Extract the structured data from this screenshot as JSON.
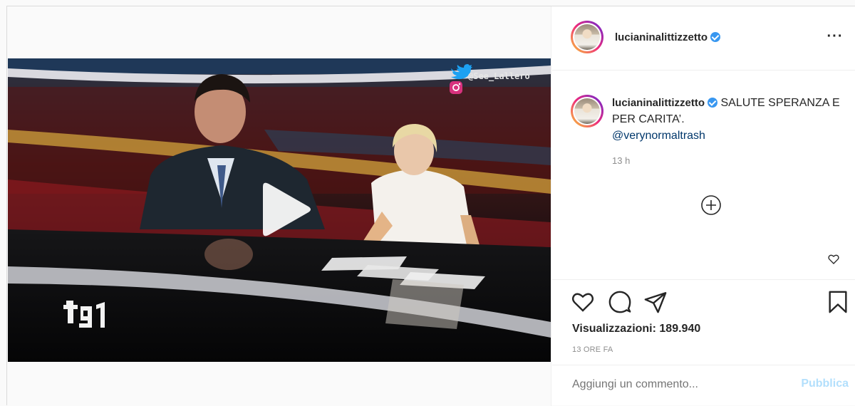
{
  "post": {
    "username": "lucianinalittizzetto",
    "caption_text": "SALUTE SPERANZA E PER CARITA’.",
    "mention": "@verynormaltrash",
    "comment_time": "13 h",
    "views_label": "Visualizzazioni:",
    "views_count": "189.940",
    "posted_ago": "13 ORE FA"
  },
  "video": {
    "watermark_handle": "@See_Lallero",
    "channel_logo": "tg1"
  },
  "comment_form": {
    "placeholder": "Aggiungi un commento...",
    "publish_label": "Pubblica"
  },
  "icons": [
    "more-options-icon",
    "verified-icon",
    "load-more-comments-icon",
    "like-comment-icon",
    "like-icon",
    "comment-icon",
    "share-icon",
    "save-icon",
    "play-icon",
    "twitter-icon",
    "instagram-icon"
  ],
  "colors": {
    "verified": "#3897f0",
    "mention": "#00376b",
    "publish_disabled": "#b2dffc",
    "muted": "#8e8e8e"
  }
}
